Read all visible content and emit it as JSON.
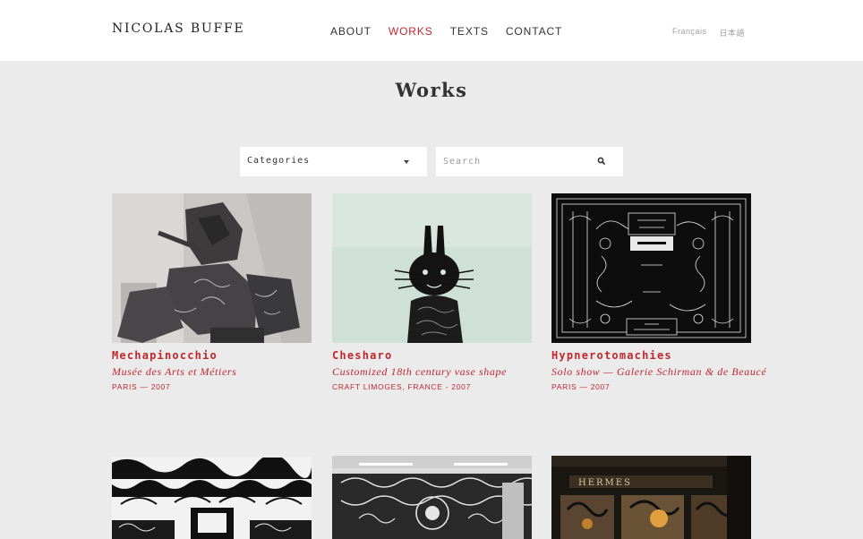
{
  "header": {
    "logo": "NICOLAS BUFFE",
    "nav": [
      {
        "label": "ABOUT",
        "active": false
      },
      {
        "label": "WORKS",
        "active": true
      },
      {
        "label": "TEXTS",
        "active": false
      },
      {
        "label": "CONTACT",
        "active": false
      }
    ],
    "languages": [
      "Français",
      "日本語"
    ]
  },
  "page": {
    "title": "Works"
  },
  "filters": {
    "categories_label": "Categories",
    "search_placeholder": "Search"
  },
  "works": [
    {
      "title": "Mechapinocchio",
      "subtitle": "Musée des Arts et Métiers",
      "meta": "PARIS — 2007"
    },
    {
      "title": "Chesharo",
      "subtitle": "Customized 18th century vase shape",
      "meta": "CRAFT LIMOGES, FRANCE - 2007"
    },
    {
      "title": "Hypnerotomachies",
      "subtitle": "Solo show — Galerie Schirman & de Beaucé",
      "meta": "PARIS — 2007"
    },
    {
      "title": "",
      "subtitle": "",
      "meta": ""
    },
    {
      "title": "",
      "subtitle": "",
      "meta": ""
    },
    {
      "title": "HERMES",
      "subtitle": "",
      "meta": ""
    }
  ],
  "colors": {
    "accent": "#c0272d",
    "background": "#ebebeb",
    "header_bg": "#ffffff"
  }
}
